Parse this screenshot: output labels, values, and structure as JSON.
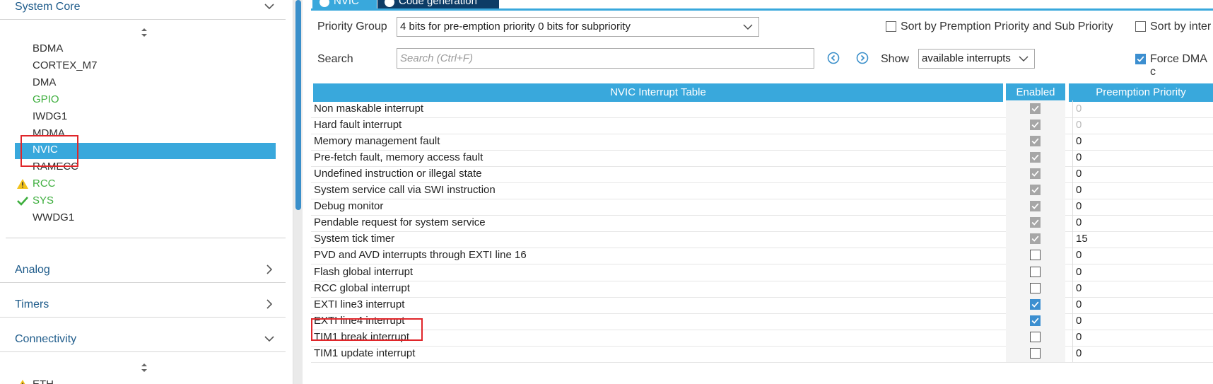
{
  "sidebar": {
    "categories": {
      "system_core": "System Core",
      "analog": "Analog",
      "timers": "Timers",
      "connectivity": "Connectivity"
    },
    "components": [
      {
        "label": "BDMA",
        "status": "none"
      },
      {
        "label": "CORTEX_M7",
        "status": "none"
      },
      {
        "label": "DMA",
        "status": "none"
      },
      {
        "label": "GPIO",
        "status": "ok"
      },
      {
        "label": "IWDG1",
        "status": "none"
      },
      {
        "label": "MDMA",
        "status": "none"
      },
      {
        "label": "NVIC",
        "status": "selected"
      },
      {
        "label": "RAMECC",
        "status": "none"
      },
      {
        "label": "RCC",
        "status": "warning"
      },
      {
        "label": "SYS",
        "status": "checked"
      },
      {
        "label": "WWDG1",
        "status": "none"
      }
    ],
    "connectivity_first": {
      "label": "ETH",
      "status": "warning"
    }
  },
  "tabs": {
    "nvic": "NVIC",
    "code_generation": "Code generation"
  },
  "toolbar": {
    "priority_group_label": "Priority Group",
    "priority_group_value": "4 bits for pre-emption priority 0 bits for subpriority",
    "sort_premption": "Sort by Premption Priority and Sub Priority",
    "sort_interrupts": "Sort by inter",
    "search_label": "Search",
    "search_placeholder": "Search (Ctrl+F)",
    "show_label": "Show",
    "show_value": "available interrupts",
    "force_dma": "Force DMA c"
  },
  "table": {
    "headers": {
      "name": "NVIC Interrupt Table",
      "enabled": "Enabled",
      "preemption": "Preemption Priority"
    },
    "rows": [
      {
        "name": "Non maskable interrupt",
        "enabled": "locked",
        "priority": "0",
        "dim": true
      },
      {
        "name": "Hard fault interrupt",
        "enabled": "locked",
        "priority": "0",
        "dim": true
      },
      {
        "name": "Memory management fault",
        "enabled": "locked",
        "priority": "0",
        "dim": false
      },
      {
        "name": "Pre-fetch fault, memory access fault",
        "enabled": "locked",
        "priority": "0",
        "dim": false
      },
      {
        "name": "Undefined instruction or illegal state",
        "enabled": "locked",
        "priority": "0",
        "dim": false
      },
      {
        "name": "System service call via SWI instruction",
        "enabled": "locked",
        "priority": "0",
        "dim": false
      },
      {
        "name": "Debug monitor",
        "enabled": "locked",
        "priority": "0",
        "dim": false
      },
      {
        "name": "Pendable request for system service",
        "enabled": "locked",
        "priority": "0",
        "dim": false
      },
      {
        "name": "System tick timer",
        "enabled": "locked",
        "priority": "15",
        "dim": false
      },
      {
        "name": "PVD and AVD interrupts through EXTI line 16",
        "enabled": "off",
        "priority": "0",
        "dim": false
      },
      {
        "name": "Flash global interrupt",
        "enabled": "off",
        "priority": "0",
        "dim": false
      },
      {
        "name": "RCC global interrupt",
        "enabled": "off",
        "priority": "0",
        "dim": false
      },
      {
        "name": "EXTI line3 interrupt",
        "enabled": "on",
        "priority": "0",
        "dim": false
      },
      {
        "name": "EXTI line4 interrupt",
        "enabled": "on",
        "priority": "0",
        "dim": false
      },
      {
        "name": "TIM1 break interrupt",
        "enabled": "off",
        "priority": "0",
        "dim": false
      },
      {
        "name": "TIM1 update interrupt",
        "enabled": "off",
        "priority": "0",
        "dim": false
      }
    ]
  },
  "colors": {
    "accent": "#39a8dc",
    "tab_dark": "#0d3c66",
    "category_text": "#1f5c8b",
    "ok_green": "#3dae3d",
    "warning_yellow": "#f2c21b",
    "highlight_red": "#e0262a",
    "checkbox_blue": "#3c8fd0"
  }
}
